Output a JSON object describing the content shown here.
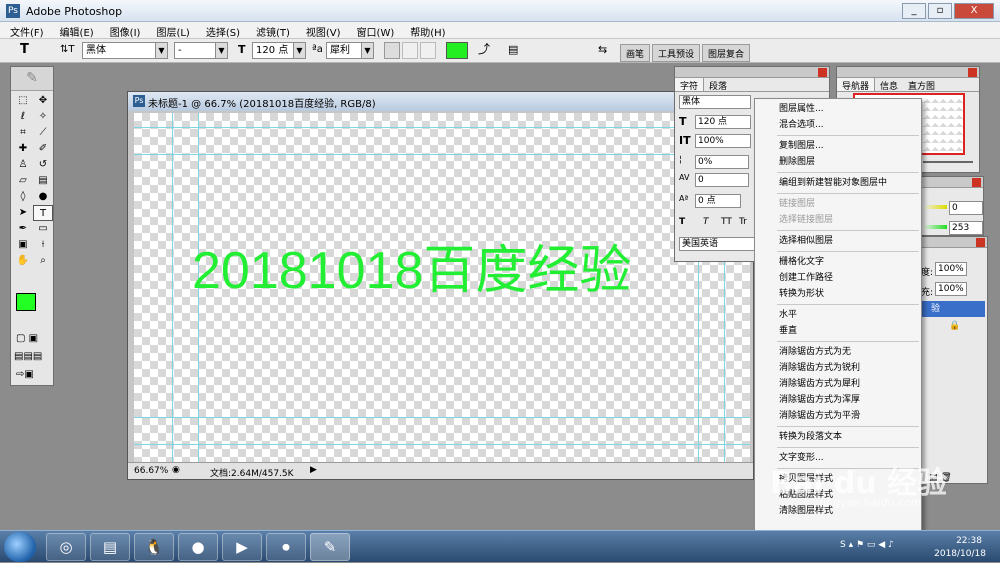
{
  "app": {
    "title": "Adobe Photoshop"
  },
  "window_buttons": {
    "minimize": "_",
    "restore": "▫",
    "close": "X"
  },
  "menubar": [
    "文件(F)",
    "编辑(E)",
    "图像(I)",
    "图层(L)",
    "选择(S)",
    "滤镜(T)",
    "视图(V)",
    "窗口(W)",
    "帮助(H)"
  ],
  "options": {
    "tool_glyph": "T",
    "orient_glyph": "⇅T",
    "font_family": "黑体",
    "font_style": "-",
    "size_icon": "T",
    "font_size": "120 点",
    "aa_icon": "ªa",
    "antialias": "犀利",
    "text_color": "#22ee22"
  },
  "palette_well": [
    "画笔",
    "工具预设",
    "图层复合"
  ],
  "document": {
    "title": "未标题-1 @ 66.7% (20181018百度经验, RGB/8)",
    "canvas_text": "20181018百度经验",
    "text_color": "#22ee33",
    "zoom": "66.67%",
    "doc_info": "文档:2.64M/457.5K"
  },
  "char_panel": {
    "tab_char": "字符",
    "tab_para": "段落",
    "font": "黑体",
    "size": "120 点",
    "leading": "100%",
    "tracking": "0%",
    "kerning": "0",
    "baseline": "0 点",
    "style_buttons": [
      "T",
      "T",
      "TT",
      "Tr"
    ],
    "language": "美国英语"
  },
  "nav_panel": {
    "tabs": [
      "导航器",
      "信息",
      "直方图"
    ]
  },
  "color_panel": {
    "values": [
      "0",
      "253"
    ]
  },
  "layer_panel": {
    "opacity_label": "度:",
    "opacity": "100%",
    "fill_label": "充:",
    "fill": "100%",
    "layer_name": "验"
  },
  "context_menu": [
    {
      "label": "图层属性...",
      "disabled": false
    },
    {
      "label": "混合选项...",
      "disabled": false
    },
    {
      "sep": true
    },
    {
      "label": "复制图层...",
      "disabled": false
    },
    {
      "label": "删除图层",
      "disabled": false
    },
    {
      "sep": true
    },
    {
      "label": "编组到新建智能对象图层中",
      "disabled": false
    },
    {
      "sep": true
    },
    {
      "label": "链接图层",
      "disabled": true
    },
    {
      "label": "选择链接图层",
      "disabled": true
    },
    {
      "sep": true
    },
    {
      "label": "选择相似图层",
      "disabled": false
    },
    {
      "sep": true
    },
    {
      "label": "栅格化文字",
      "disabled": false
    },
    {
      "label": "创建工作路径",
      "disabled": false
    },
    {
      "label": "转换为形状",
      "disabled": false
    },
    {
      "sep": true
    },
    {
      "label": "水平",
      "disabled": false
    },
    {
      "label": "垂直",
      "disabled": false
    },
    {
      "sep": true
    },
    {
      "label": "消除锯齿方式为无",
      "disabled": false
    },
    {
      "label": "消除锯齿方式为锐利",
      "disabled": false
    },
    {
      "label": "消除锯齿方式为犀利",
      "disabled": false
    },
    {
      "label": "消除锯齿方式为浑厚",
      "disabled": false
    },
    {
      "label": "消除锯齿方式为平滑",
      "disabled": false
    },
    {
      "sep": true
    },
    {
      "label": "转换为段落文本",
      "disabled": false
    },
    {
      "sep": true
    },
    {
      "label": "文字变形...",
      "disabled": false
    },
    {
      "sep": true
    },
    {
      "label": "拷贝图层样式",
      "disabled": false
    },
    {
      "label": "粘贴图层样式",
      "disabled": false
    },
    {
      "label": "清除图层样式",
      "disabled": false
    }
  ],
  "taskbar": {
    "apps": [
      "◎",
      "▤",
      "🐧",
      "●",
      "▶",
      "⏺",
      "✎"
    ],
    "time": "22:38",
    "date": "2018/10/18"
  },
  "watermark": {
    "text": "Bai du 经验",
    "sub": "jingyan.baidu.com"
  }
}
